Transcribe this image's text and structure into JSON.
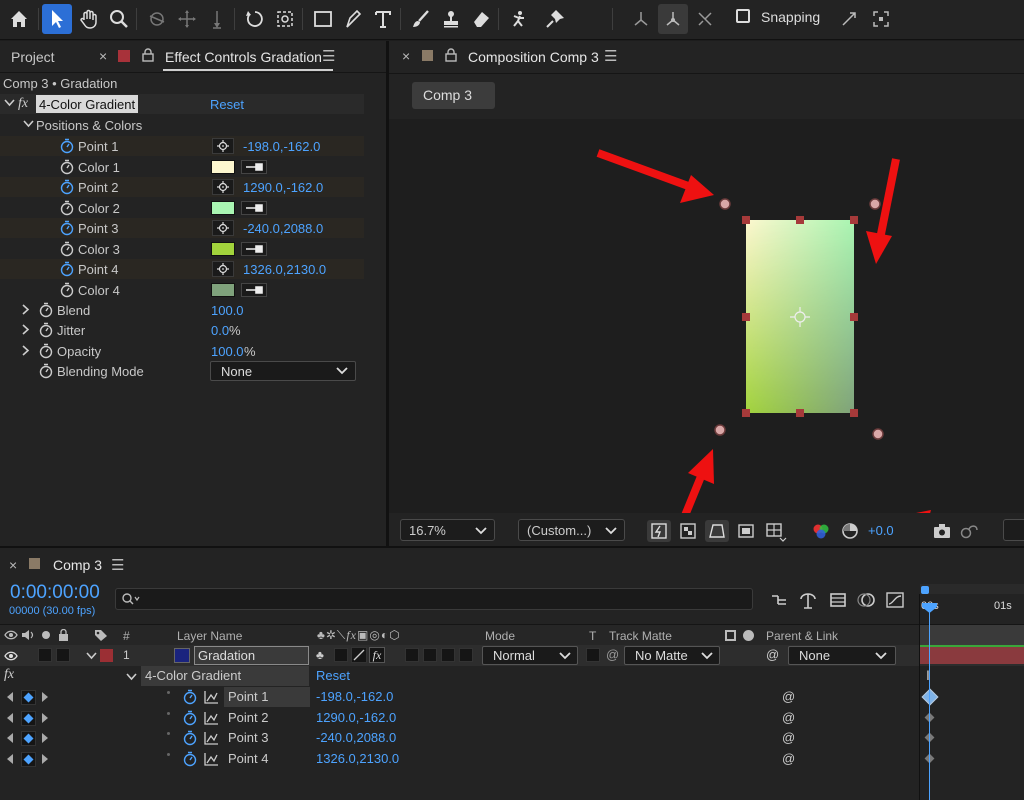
{
  "toolbar": {
    "tools": [
      "home-icon",
      "selection-tool-icon",
      "hand-tool-icon",
      "zoom-tool-icon",
      "rotate-camera-icon",
      "pan-camera-icon",
      "dolly-camera-icon",
      "rotation-tool-icon",
      "pan-behind-icon",
      "rectangle-tool-icon",
      "pen-tool-icon",
      "type-tool-icon",
      "brush-tool-icon",
      "clone-stamp-icon",
      "eraser-icon",
      "roto-brush-icon",
      "puppet-pin-icon"
    ],
    "snapping_label": "Snapping"
  },
  "effect_controls": {
    "project_tab": "Project",
    "tab_title": "Effect Controls Gradation",
    "breadcrumb": "Comp 3 • Gradation",
    "effect_name": "4-Color Gradient",
    "reset": "Reset",
    "group": "Positions & Colors",
    "props": [
      {
        "name": "Point 1",
        "value": "-198.0,-162.0",
        "kind": "point"
      },
      {
        "name": "Color 1",
        "color": "#fdf7cf",
        "kind": "color"
      },
      {
        "name": "Point 2",
        "value": "1290.0,-162.0",
        "kind": "point"
      },
      {
        "name": "Color 2",
        "color": "#a9f5b2",
        "kind": "color"
      },
      {
        "name": "Point 3",
        "value": "-240.0,2088.0",
        "kind": "point"
      },
      {
        "name": "Color 3",
        "color": "#a2d33c",
        "kind": "color"
      },
      {
        "name": "Point 4",
        "value": "1326.0,2130.0",
        "kind": "point"
      },
      {
        "name": "Color 4",
        "color": "#7fa27c",
        "kind": "color"
      }
    ],
    "blend": {
      "name": "Blend",
      "value": "100.0"
    },
    "jitter": {
      "name": "Jitter",
      "value": "0.0",
      "unit": "%"
    },
    "opacity": {
      "name": "Opacity",
      "value": "100.0",
      "unit": "%"
    },
    "blending_mode": {
      "name": "Blending Mode",
      "value": "None"
    }
  },
  "composition": {
    "tab_title": "Composition Comp 3",
    "comp_button": "Comp 3",
    "zoom": "16.7%",
    "resolution": "(Custom...)",
    "exposure": "+0.0",
    "gradient_colors": [
      "#fdf7cf",
      "#a9f5b2",
      "#a2d33c",
      "#7fa27c"
    ],
    "arrow_color": "#ee1111"
  },
  "timeline": {
    "tab_title": "Comp 3",
    "timecode": "0:00:00:00",
    "frames": "00000 (30.00 fps)",
    "search_placeholder": "",
    "headers": {
      "layer_name": "Layer Name",
      "mode": "Mode",
      "t": "T",
      "track_matte": "Track Matte",
      "parent_link": "Parent & Link",
      "number": "#"
    },
    "layer": {
      "index": "1",
      "name": "Gradation",
      "mode": "Normal",
      "matte": "No Matte",
      "parent": "None",
      "label_color": "#1a237e"
    },
    "effect": {
      "name": "4-Color Gradient",
      "reset": "Reset"
    },
    "points": [
      {
        "name": "Point 1",
        "value": "-198.0,-162.0"
      },
      {
        "name": "Point 2",
        "value": "1290.0,-162.0"
      },
      {
        "name": "Point 3",
        "value": "-240.0,2088.0"
      },
      {
        "name": "Point 4",
        "value": "1326.0,2130.0"
      }
    ],
    "ruler": [
      "00s",
      "01s"
    ]
  }
}
